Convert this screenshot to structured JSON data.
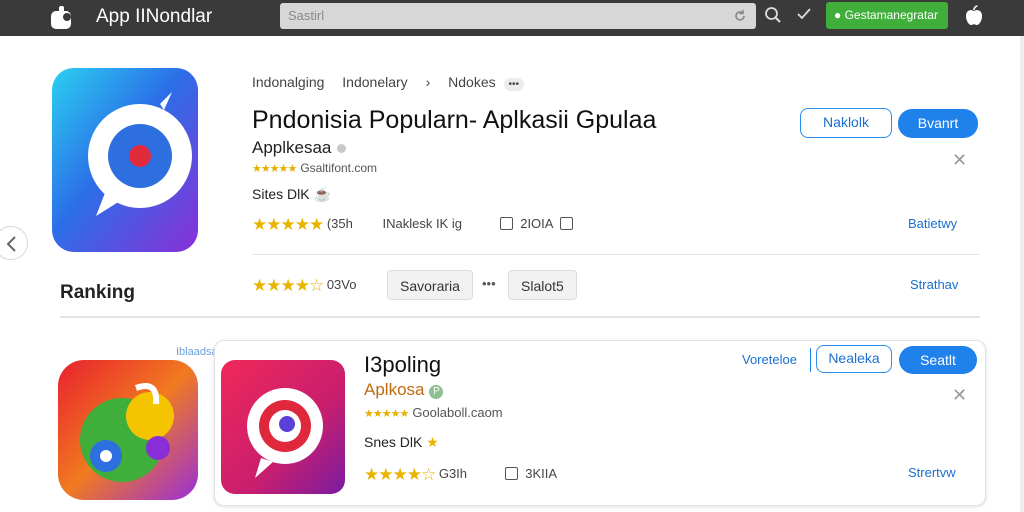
{
  "topbar": {
    "app_title": "App IINondlar",
    "search_placeholder": "Sastirl",
    "green_button": "Gestamanegratar",
    "logo_icon": "apple-logo-icon",
    "search_icon": "search-icon",
    "check_icon": "check-icon"
  },
  "featured": {
    "breadcrumb": [
      "Indonalging",
      "Indonelary",
      "Ndokes"
    ],
    "breadcrumb_badge": "•••",
    "title": "Pndonisia Popularn- Aplkasii Gpulaa",
    "developer": "Applkesaa",
    "small_rating_text": "Gsaltifont.com",
    "size": "Sites DlK",
    "rating_count": "(35h",
    "downloads": "INaklesk IK ig",
    "stat_value": "2IOIA",
    "btn_outline": "Naklolk",
    "btn_fill": "Bvanrt",
    "link1": "Batietwy"
  },
  "ranking": {
    "label": "Ranking",
    "rating_count": "03Vo",
    "chip1": "Savoraria",
    "chip_more": "•••",
    "chip2": "Slalot5",
    "link": "Strathav"
  },
  "card": {
    "tag": "Iblaadsaa",
    "title": "I3poling",
    "developer": "Aplkosa",
    "developer_badge": "P",
    "small_rating_text": "Goolaboll.caom",
    "size": "Snes DlK",
    "rating_count": "G3Ih",
    "stat_value": "3KIIA",
    "link1": "Voreteloe",
    "btn_outline": "Nealeka",
    "btn_fill": "Seatlt",
    "link2": "Strertvw"
  },
  "colors": {
    "accent": "#1f82ea",
    "green": "#3fae3a",
    "star": "#e8b400",
    "topbar": "#3a3a3a"
  }
}
